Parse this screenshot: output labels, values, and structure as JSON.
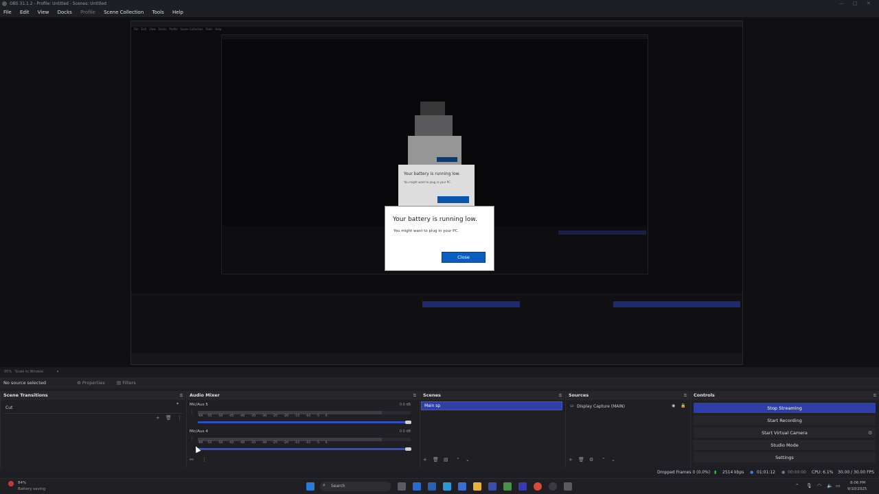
{
  "window": {
    "title": "OBS 31.1.2 - Profile: Untitled - Scenes: Untitled"
  },
  "menu": [
    "File",
    "Edit",
    "View",
    "Docks",
    "Profile",
    "Scene Collection",
    "Tools",
    "Help"
  ],
  "dialog": {
    "title": "Your battery is running low.",
    "message": "You might want to plug in your PC.",
    "close_label": "Close"
  },
  "zoom": {
    "value": "95%",
    "mode": "Scale to Window"
  },
  "source_toolbar": {
    "no_source": "No source selected",
    "properties": "Properties",
    "filters": "Filters"
  },
  "docks": {
    "scene_transitions": {
      "title": "Scene Transitions",
      "selected": "Cut"
    },
    "audio_mixer": {
      "title": "Audio Mixer",
      "channels": [
        {
          "name": "Mic/Aux 5",
          "db": "0.0 dB"
        },
        {
          "name": "Mic/Aux 4",
          "db": "0.0 dB"
        }
      ],
      "ticks": [
        "-60",
        "-55",
        "-50",
        "-45",
        "-40",
        "-35",
        "-30",
        "-25",
        "-20",
        "-15",
        "-10",
        "-5",
        "0"
      ]
    },
    "scenes": {
      "title": "Scenes",
      "items": [
        "Main sp"
      ]
    },
    "sources": {
      "title": "Sources",
      "items": [
        "Display Capture (MAIN)"
      ]
    },
    "controls": {
      "title": "Controls",
      "buttons": [
        "Stop Streaming",
        "Start Recording",
        "Start Virtual Camera",
        "Studio Mode",
        "Settings"
      ]
    }
  },
  "status": {
    "dropped": "Dropped Frames 0 (0.0%)",
    "bitrate": "2514 kbps",
    "stream_time": "01:01:12",
    "rec_time": "00:00:00",
    "cpu": "CPU: 6.1%",
    "fps": "30.00 / 30.00 FPS"
  },
  "taskbar": {
    "battery_label": "84%",
    "battery_sub": "Battery saving",
    "search": "Search",
    "time": "8:06 PM",
    "date": "9/10/2025"
  },
  "colors": {
    "accent": "#2e3fa8",
    "dialog_button": "#0a5ec0"
  }
}
